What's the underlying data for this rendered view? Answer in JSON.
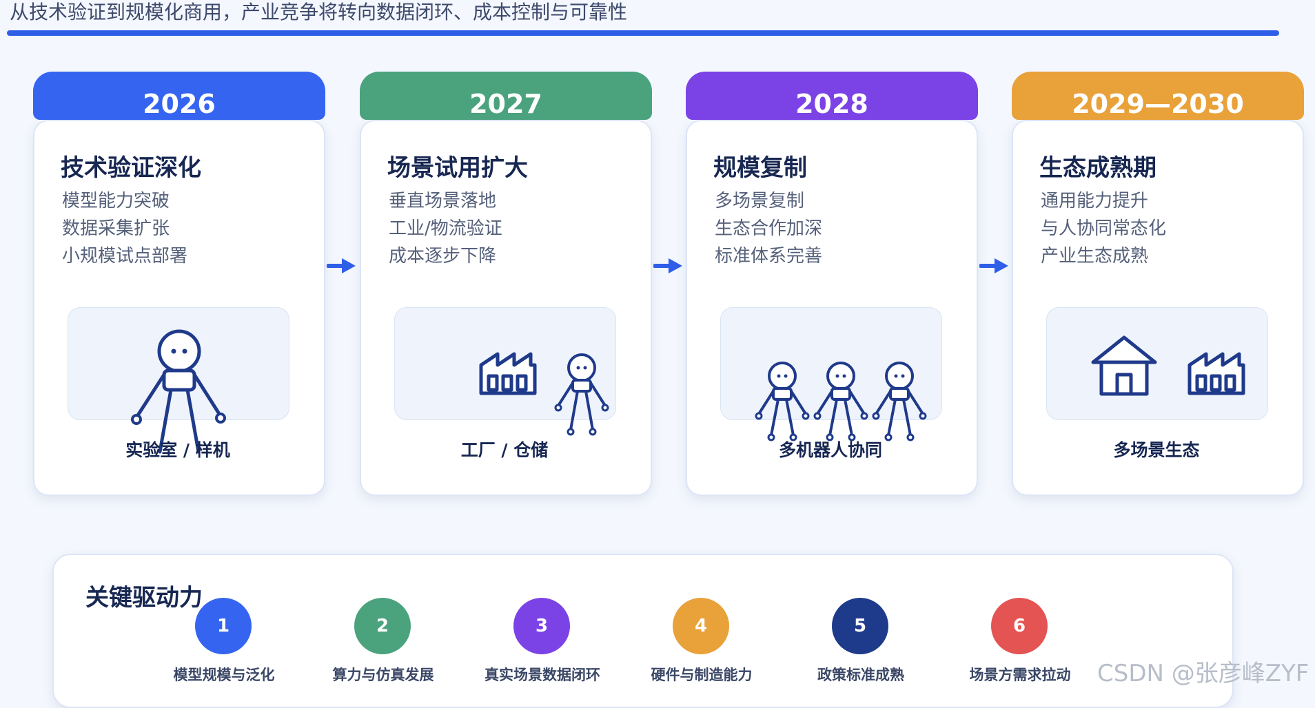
{
  "subtitle": "从技术验证到规模化商用，产业竞争将转向数据闭环、成本控制与可靠性",
  "stages": [
    {
      "year": "2026",
      "color": "#3565f0",
      "title": "技术验证深化",
      "items": [
        "模型能力突破",
        "数据采集扩张",
        "小规模试点部署"
      ],
      "caption": "实验室 / 样机",
      "illustration_icons": [
        "robot-icon"
      ]
    },
    {
      "year": "2027",
      "color": "#4aa37d",
      "title": "场景试用扩大",
      "items": [
        "垂直场景落地",
        "工业/物流验证",
        "成本逐步下降"
      ],
      "caption": "工厂 / 仓储",
      "illustration_icons": [
        "factory-icon",
        "robot-icon"
      ]
    },
    {
      "year": "2028",
      "color": "#7b43e6",
      "title": "规模复制",
      "items": [
        "多场景复制",
        "生态合作加深",
        "标准体系完善"
      ],
      "caption": "多机器人协同",
      "illustration_icons": [
        "robot-icon",
        "robot-icon",
        "robot-icon"
      ]
    },
    {
      "year": "2029—2030",
      "color": "#e9a13a",
      "title": "生态成熟期",
      "items": [
        "通用能力提升",
        "与人协同常态化",
        "产业生态成熟"
      ],
      "caption": "多场景生态",
      "illustration_icons": [
        "house-icon",
        "factory-icon"
      ]
    }
  ],
  "arrow_color": "#2f5ee8",
  "drivers": {
    "title": "关键驱动力",
    "items": [
      {
        "num": "1",
        "label": "模型规模与泛化",
        "color": "#3565f0"
      },
      {
        "num": "2",
        "label": "算力与仿真发展",
        "color": "#4aa37d"
      },
      {
        "num": "3",
        "label": "真实场景数据闭环",
        "color": "#7b43e6"
      },
      {
        "num": "4",
        "label": "硬件与制造能力",
        "color": "#e9a13a"
      },
      {
        "num": "5",
        "label": "政策标准成熟",
        "color": "#1e3a8a"
      },
      {
        "num": "6",
        "label": "场景方需求拉动",
        "color": "#e35452"
      }
    ]
  },
  "watermark": "CSDN @张彦峰ZYF"
}
